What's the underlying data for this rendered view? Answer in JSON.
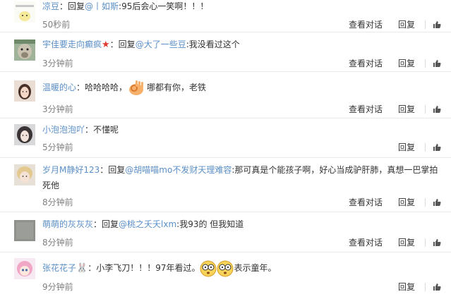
{
  "actions": {
    "view": "查看对话",
    "reply": "回复"
  },
  "comments": [
    {
      "name": "凉豆",
      "sep": "：回复",
      "target": "@丨如斯",
      "text": ":95后会心一笑啊！！！",
      "time": "50秒前"
    },
    {
      "name": "宇佳要走向癫疯",
      "sep": "：回复",
      "target": "@大了一些豆",
      "text": ":我没看过这个",
      "time": "3分钟前"
    },
    {
      "name": "温暖的心",
      "text1": "：哈哈哈哈，",
      "text2": "哪都有你，老铁",
      "time": "3分钟前"
    },
    {
      "name": "小泡泡泡吖",
      "text": "：不懂呢",
      "time": "5分钟前"
    },
    {
      "name": "岁月M静好123",
      "sep": "：回复",
      "target": "@胡喵喵mo不发财天理难容",
      "text": ":那可真是个能孩子啊，好心当成驴肝肺，真想一巴掌拍死他",
      "time": "8分钟前"
    },
    {
      "name": "萌萌的灰灰灰",
      "sep": "：回复",
      "target": "@桃之夭夭lxm",
      "text": ":我93的 但我知道",
      "time": "8分钟前"
    },
    {
      "name": "张花花子",
      "text1": "：小李飞刀！！！97年看过。",
      "text2": "表示童年。",
      "time": "9分钟前"
    }
  ]
}
